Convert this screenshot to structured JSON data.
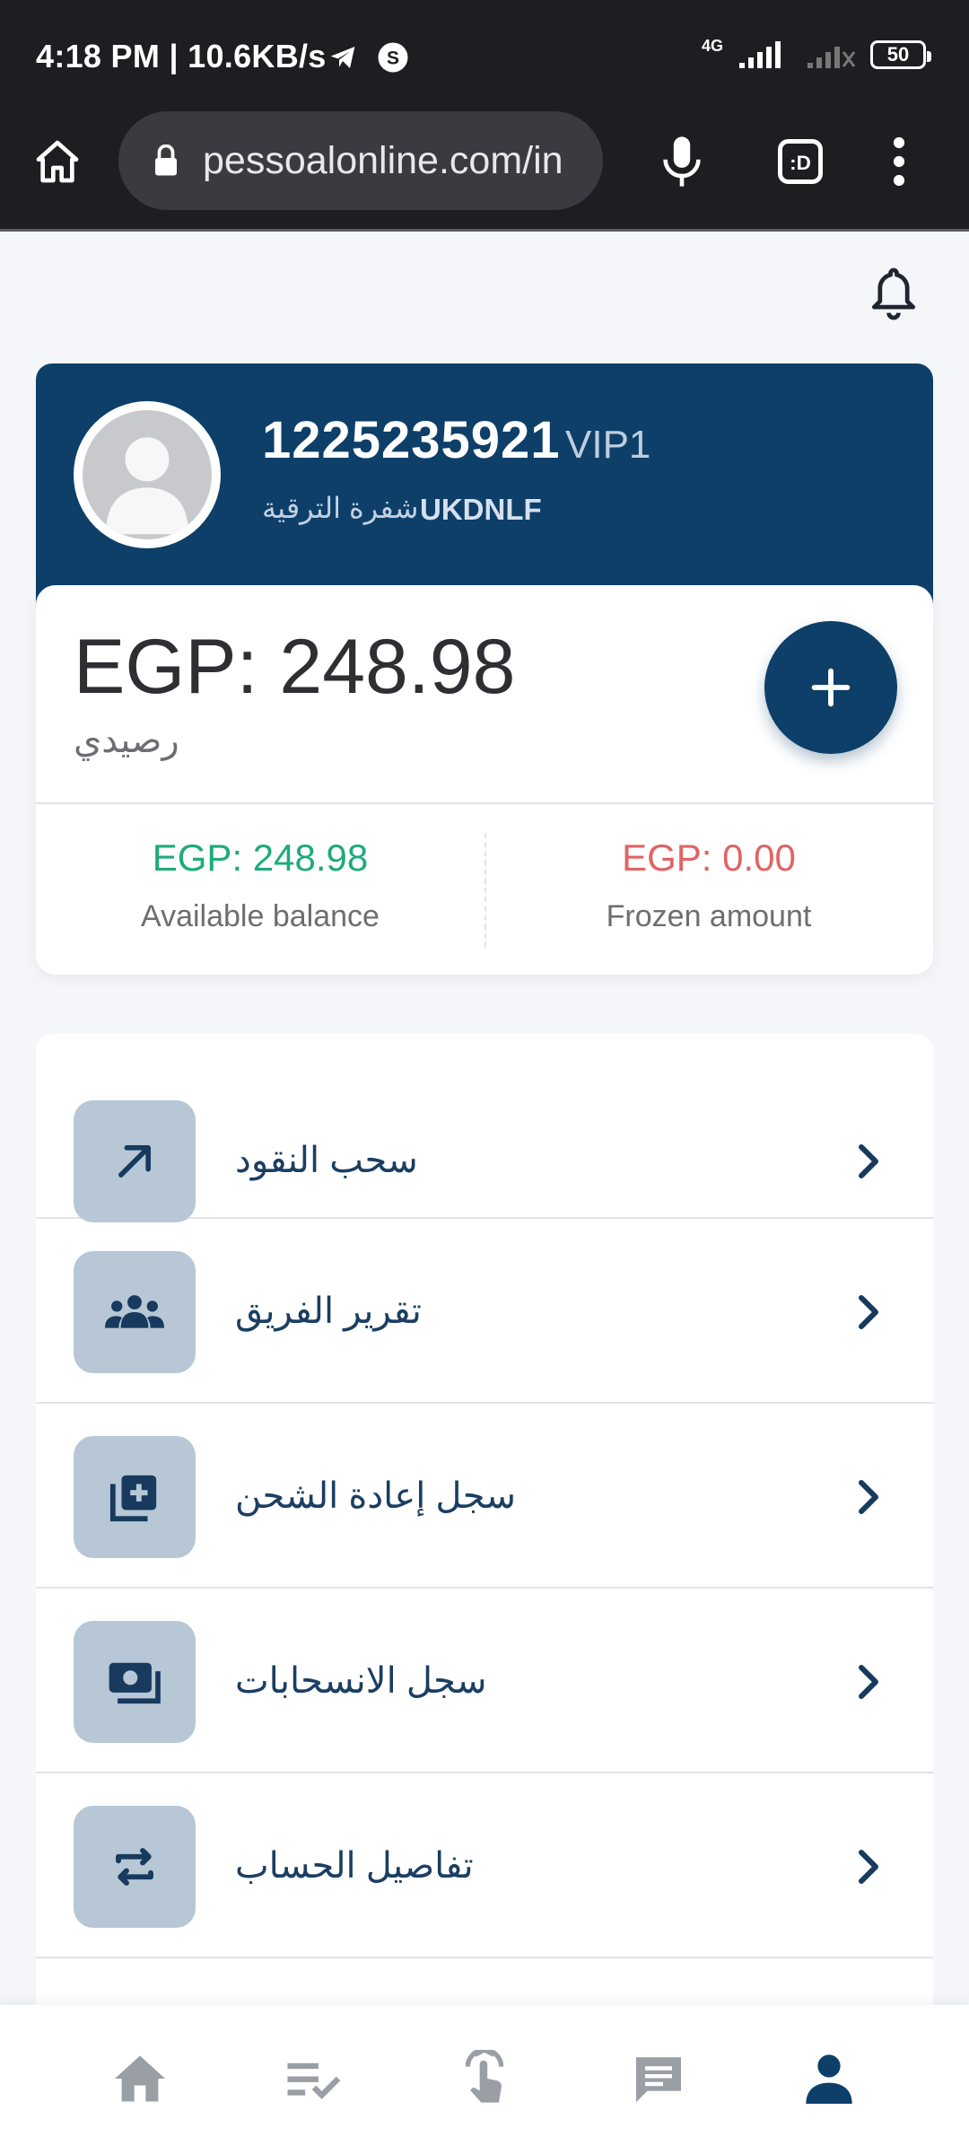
{
  "status_bar": {
    "time_speed": "4:18 PM | 10.6KB/s",
    "network": "4G",
    "battery": "50"
  },
  "browser": {
    "url": "pessoalonline.com/in"
  },
  "profile": {
    "user_id": "1225235921",
    "vip": "VIP1",
    "invite_label": "شفرة الترقية",
    "invite_code": "UKDNLF"
  },
  "balance": {
    "main": "EGP: 248.98",
    "label": "رصيدي",
    "available_amount": "EGP: 248.98",
    "available_label": "Available balance",
    "frozen_amount": "EGP: 0.00",
    "frozen_label": "Frozen amount",
    "available_color": "#1eaa7c",
    "frozen_color": "#e06464"
  },
  "menu": [
    {
      "label": "سحب النقود",
      "icon": "arrow-up-right-icon"
    },
    {
      "label": "تقرير الفريق",
      "icon": "team-icon"
    },
    {
      "label": "سجل إعادة الشحن",
      "icon": "add-box-icon"
    },
    {
      "label": "سجل الانسحابات",
      "icon": "wallet-icon"
    },
    {
      "label": "تفاصيل الحساب",
      "icon": "swap-icon"
    }
  ],
  "bottom_nav": [
    {
      "icon": "home-icon",
      "active": false
    },
    {
      "icon": "checklist-icon",
      "active": false
    },
    {
      "icon": "tap-icon",
      "active": false
    },
    {
      "icon": "chat-icon",
      "active": false
    },
    {
      "icon": "person-icon",
      "active": true
    }
  ],
  "colors": {
    "brand": "#0d3f69",
    "menu_icon_bg": "#b7c7d6",
    "nav_inactive": "#9a9ea5"
  }
}
